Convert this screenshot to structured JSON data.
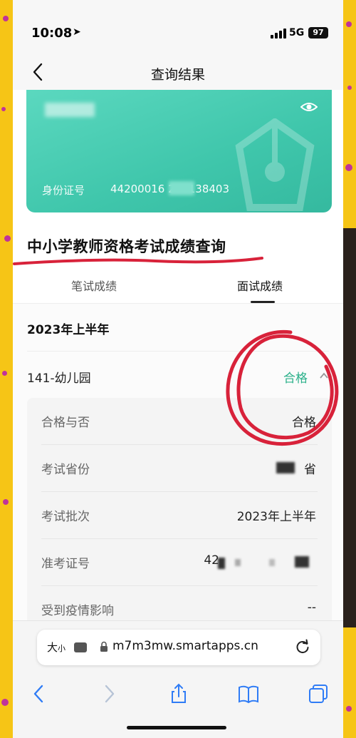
{
  "status_bar": {
    "time": "10:08",
    "network": "5G",
    "battery": "97"
  },
  "nav": {
    "title": "查询结果"
  },
  "card": {
    "id_label": "身份证号",
    "id_value": "44200016 206138403"
  },
  "page_heading": "中小学教师资格考试成绩查询",
  "tabs": [
    {
      "label": "笔试成绩"
    },
    {
      "label": "面试成绩"
    }
  ],
  "year": "2023年上半年",
  "subject": {
    "label": "141-幼儿园",
    "status": "合格"
  },
  "details": [
    {
      "label": "合格与否",
      "value": "合格"
    },
    {
      "label": "考试省份",
      "value": "省"
    },
    {
      "label": "考试批次",
      "value": "2023年上半年"
    },
    {
      "label": "准考证号",
      "value": "42"
    },
    {
      "label": "受到疫情影响",
      "value": "--"
    }
  ],
  "browser": {
    "aa_label": "大",
    "aa_small": "小",
    "url": "m7m3mw.smartapps.cn"
  },
  "colors": {
    "accent_green": "#3fc6ab",
    "pass_green": "#2ab08a",
    "annotation_red": "#d8223a",
    "frame_yellow": "#f6c516"
  },
  "icons": [
    "location-arrow-icon",
    "signal-icon",
    "back-chevron-icon",
    "eye-icon",
    "chevron-up-icon",
    "lock-icon",
    "reload-icon",
    "back-icon",
    "forward-icon",
    "share-icon",
    "bookmarks-icon",
    "tabs-icon"
  ]
}
